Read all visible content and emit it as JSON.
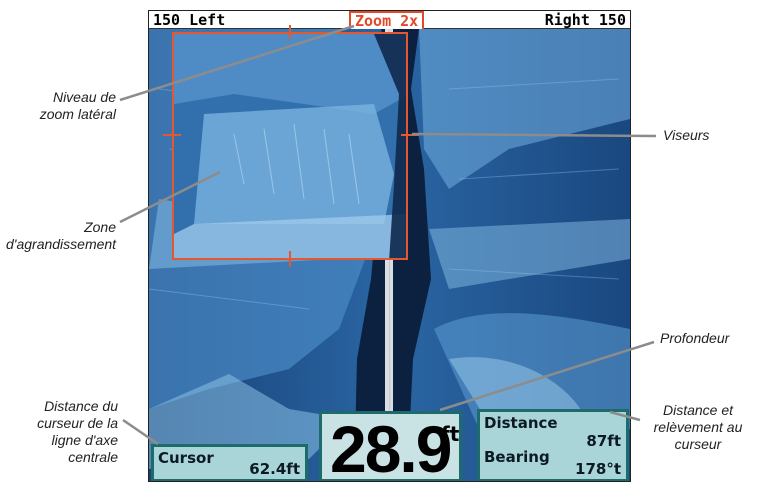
{
  "topbar": {
    "left_label": "150  Left",
    "zoom_label": "Zoom 2x",
    "right_label": "Right  150"
  },
  "cursor_box": {
    "label": "Cursor",
    "value": "62.4ft"
  },
  "depth_box": {
    "value": "28.9",
    "unit": "ft"
  },
  "distance_box": {
    "distance_label": "Distance",
    "distance_value": "87ft",
    "bearing_label": "Bearing",
    "bearing_value": "178°t"
  },
  "callouts": {
    "lateral_zoom_level": [
      "Niveau de",
      "zoom latéral"
    ],
    "zoom_area": [
      "Zone",
      "d'agrandissement"
    ],
    "crosshairs": "Viseurs",
    "depth": "Profondeur",
    "cursor_distance": [
      "Distance du",
      "curseur de la",
      "ligne d'axe",
      "centrale"
    ],
    "distance_bearing": [
      "Distance et",
      "relèvement au",
      "curseur"
    ]
  },
  "colors": {
    "accent": "#e5572f",
    "box_border": "#1e6b6b",
    "box_fill": "#a9d4d8",
    "sonar_water": "#1d4f88"
  },
  "icons": [
    "crosshair-tick"
  ]
}
